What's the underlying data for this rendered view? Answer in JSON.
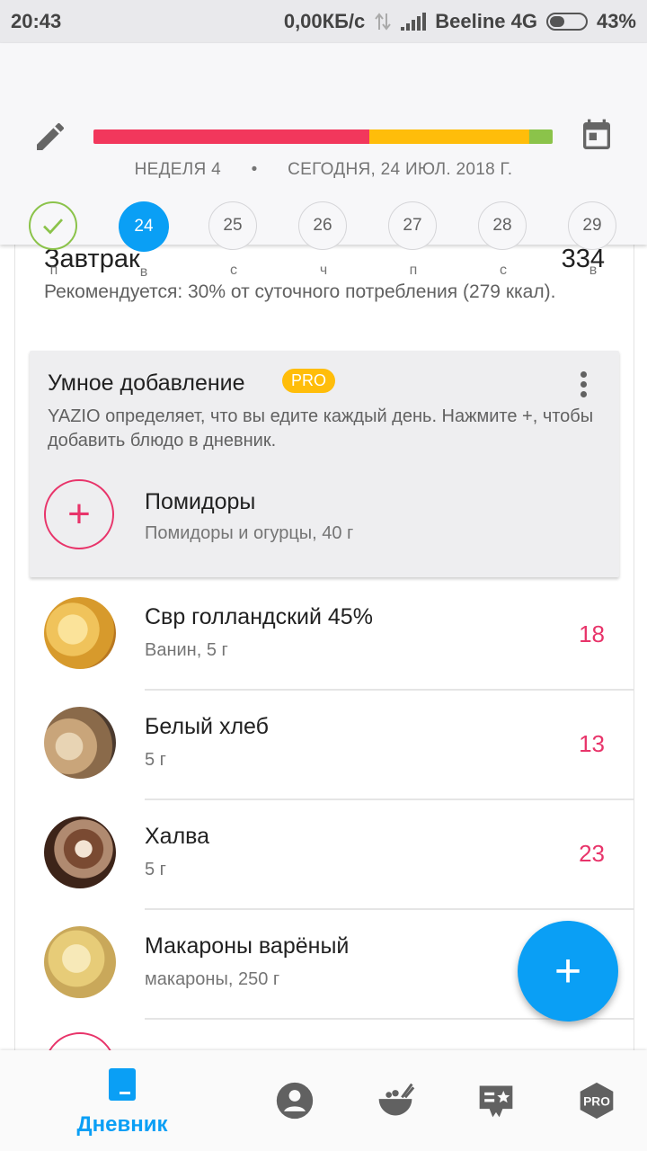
{
  "status_bar": {
    "time": "20:43",
    "network_speed": "0,00КБ/с",
    "carrier": "Beeline 4G",
    "battery": "43%",
    "battery_level": 0.43
  },
  "header": {
    "week_label": "НЕДЕЛЯ 4",
    "separator": "•",
    "date_label": "СЕГОДНЯ, 24 ИЮЛ. 2018 Г.",
    "progress": {
      "red": 0.6,
      "yellow": 0.35,
      "green": 0.05,
      "colors": {
        "red": "#f2375c",
        "yellow": "#ffbd0a",
        "green": "#8bc34a"
      }
    },
    "days": [
      {
        "num": "",
        "label": "п",
        "state": "done"
      },
      {
        "num": "24",
        "label": "в",
        "state": "active"
      },
      {
        "num": "25",
        "label": "с",
        "state": ""
      },
      {
        "num": "26",
        "label": "ч",
        "state": ""
      },
      {
        "num": "27",
        "label": "п",
        "state": ""
      },
      {
        "num": "28",
        "label": "с",
        "state": ""
      },
      {
        "num": "29",
        "label": "в",
        "state": ""
      }
    ]
  },
  "meal": {
    "title": "Завтрак",
    "kcal": "334",
    "recommendation": "Рекомендуется: 30% от суточного потребления (279 ккал)."
  },
  "smart_add": {
    "title": "Умное добавление",
    "badge": "PRO",
    "description": "YAZIO определяет, что вы едите каждый день. Нажмите +, чтобы добавить блюдо в дневник.",
    "add_symbol": "+",
    "suggestion_name": "Помидоры",
    "suggestion_sub": "Помидоры и огурцы, 40 г"
  },
  "items": [
    {
      "name": "Свр голландский 45%",
      "sub": "Ванин, 5 г",
      "kcal": "18",
      "thumb": "cheese"
    },
    {
      "name": "Белый хлеб",
      "sub": "5 г",
      "kcal": "13",
      "thumb": "bread"
    },
    {
      "name": "Халва",
      "sub": "5 г",
      "kcal": "23",
      "thumb": "halva"
    },
    {
      "name": "Макароны варёный",
      "sub": "макароны, 250 г",
      "kcal": "",
      "thumb": "pasta"
    }
  ],
  "fab": {
    "symbol": "+"
  },
  "bottom_nav": {
    "diary_label": "Дневник",
    "pro_label": "PRO",
    "accent": "#0a9ff5",
    "icons": [
      "diary-icon",
      "profile-icon",
      "recipes-icon",
      "coach-icon",
      "pro-icon"
    ]
  }
}
